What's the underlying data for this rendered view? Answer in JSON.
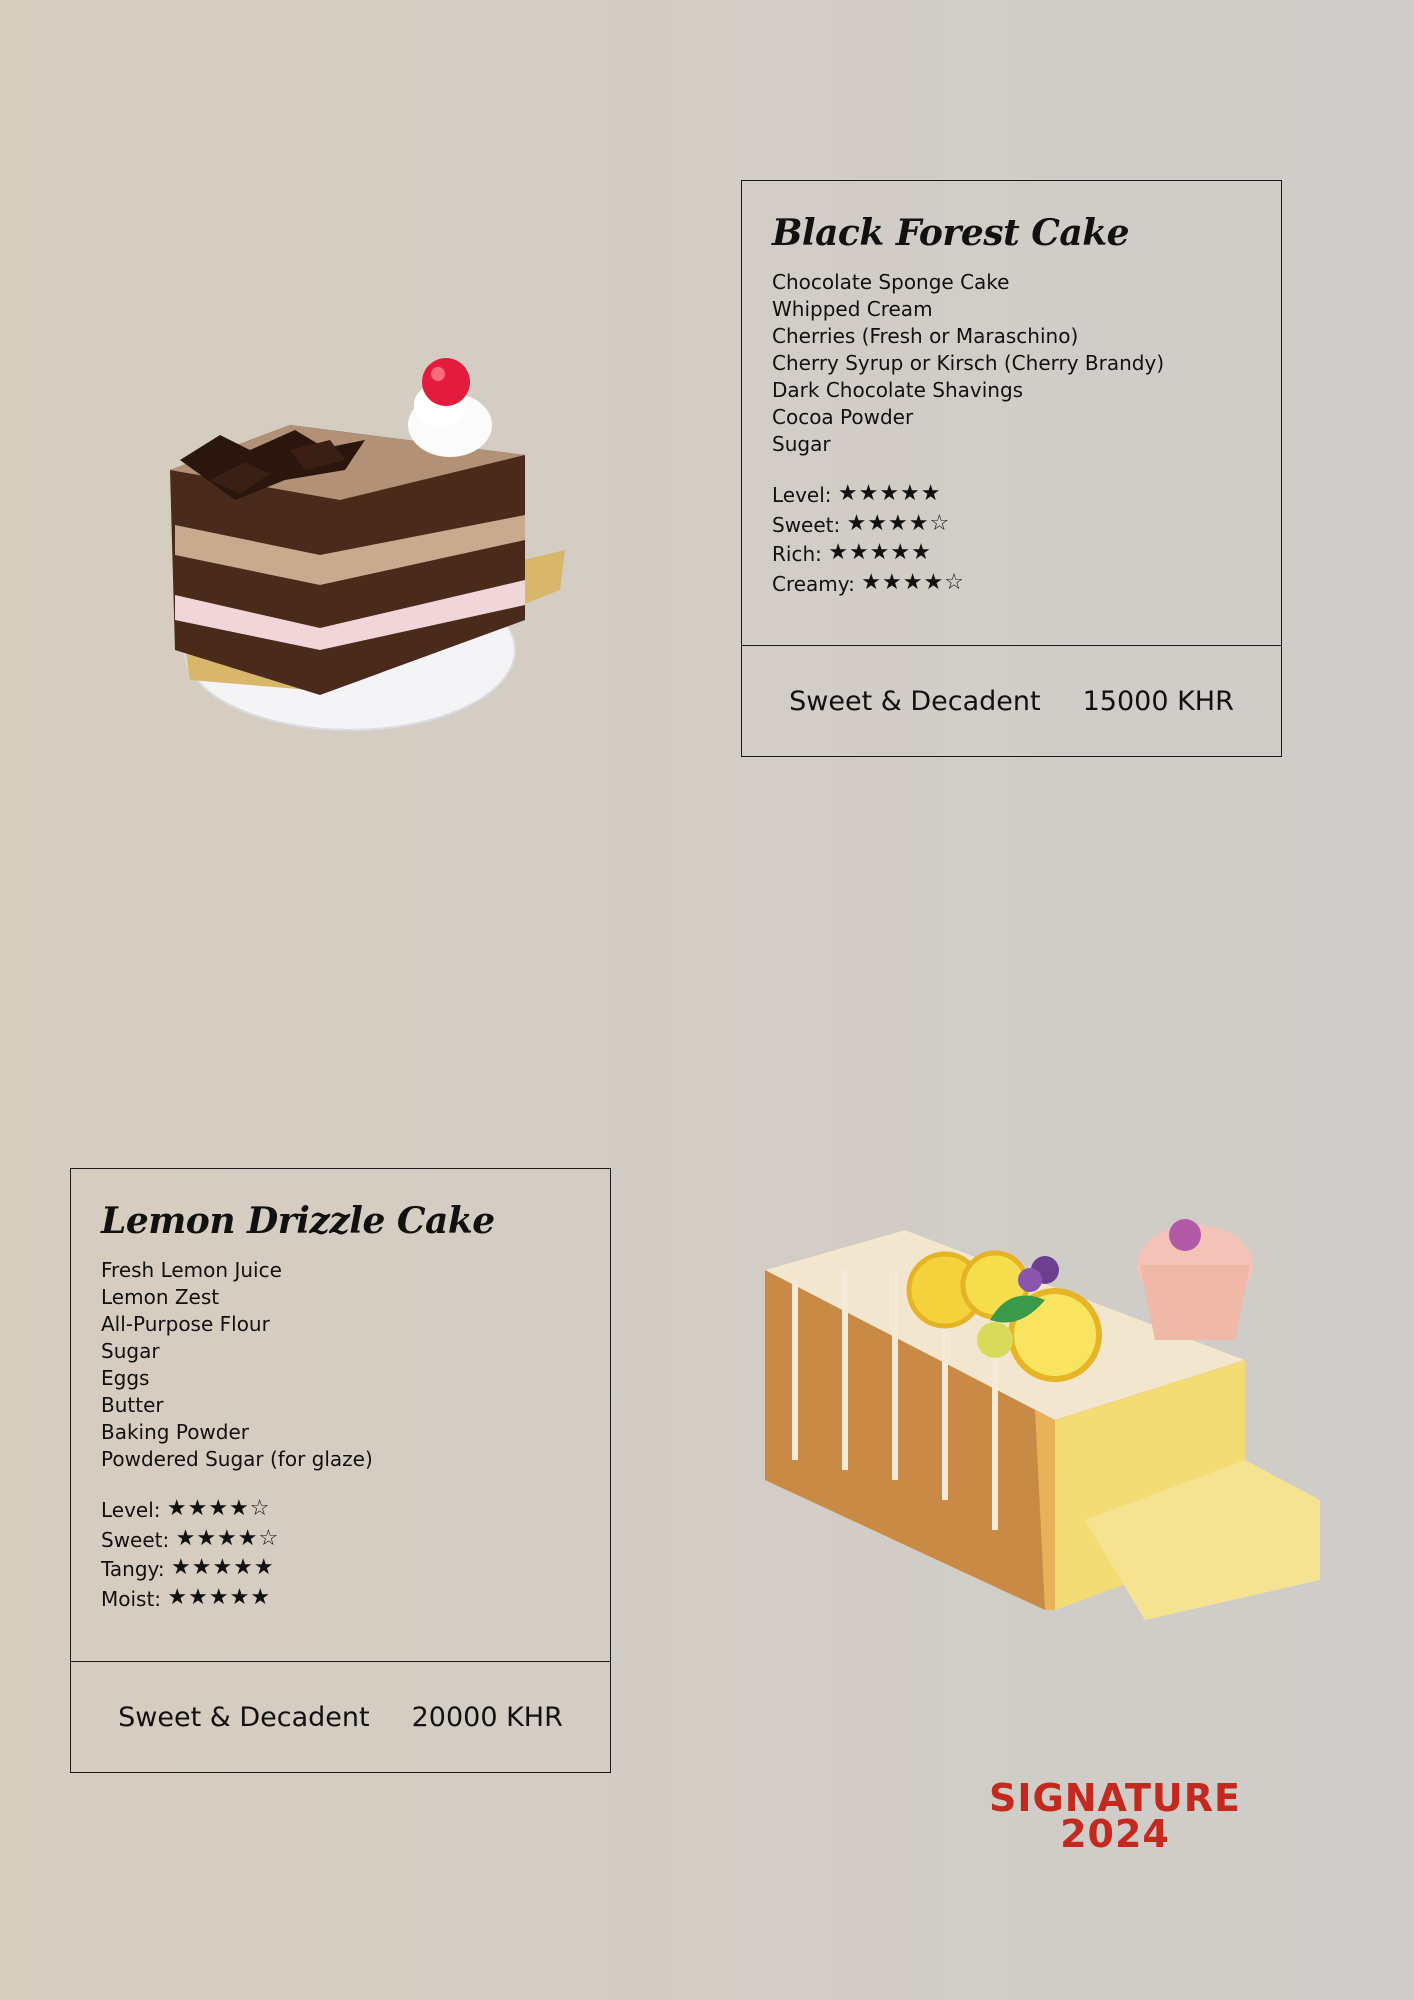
{
  "items": [
    {
      "title": "Black Forest Cake",
      "ingredients": [
        "Chocolate Sponge Cake",
        "Whipped Cream",
        "Cherries (Fresh or Maraschino)",
        "Cherry Syrup or Kirsch (Cherry Brandy)",
        "Dark Chocolate Shavings",
        "Cocoa Powder",
        "Sugar"
      ],
      "ratings": [
        {
          "label": "Level:",
          "value": 5,
          "max": 5
        },
        {
          "label": "Sweet:",
          "value": 4,
          "max": 5
        },
        {
          "label": "Rich:",
          "value": 5,
          "max": 5
        },
        {
          "label": "Creamy:",
          "value": 4,
          "max": 5
        }
      ],
      "tagline": "Sweet & Decadent",
      "price": "15000 KHR"
    },
    {
      "title": "Lemon Drizzle Cake",
      "ingredients": [
        "Fresh Lemon Juice",
        "Lemon Zest",
        "All-Purpose Flour",
        "Sugar",
        "Eggs",
        "Butter",
        "Baking Powder",
        "Powdered Sugar (for glaze)"
      ],
      "ratings": [
        {
          "label": "Level:",
          "value": 4,
          "max": 5
        },
        {
          "label": "Sweet:",
          "value": 4,
          "max": 5
        },
        {
          "label": "Tangy:",
          "value": 5,
          "max": 5
        },
        {
          "label": "Moist:",
          "value": 5,
          "max": 5
        }
      ],
      "tagline": "Sweet & Decadent",
      "price": "20000 KHR"
    }
  ],
  "badge": {
    "line1": "SIGNATURE",
    "line2": "2024"
  },
  "colors": {
    "badge": "#c4281e",
    "border": "#1a1a1a"
  }
}
